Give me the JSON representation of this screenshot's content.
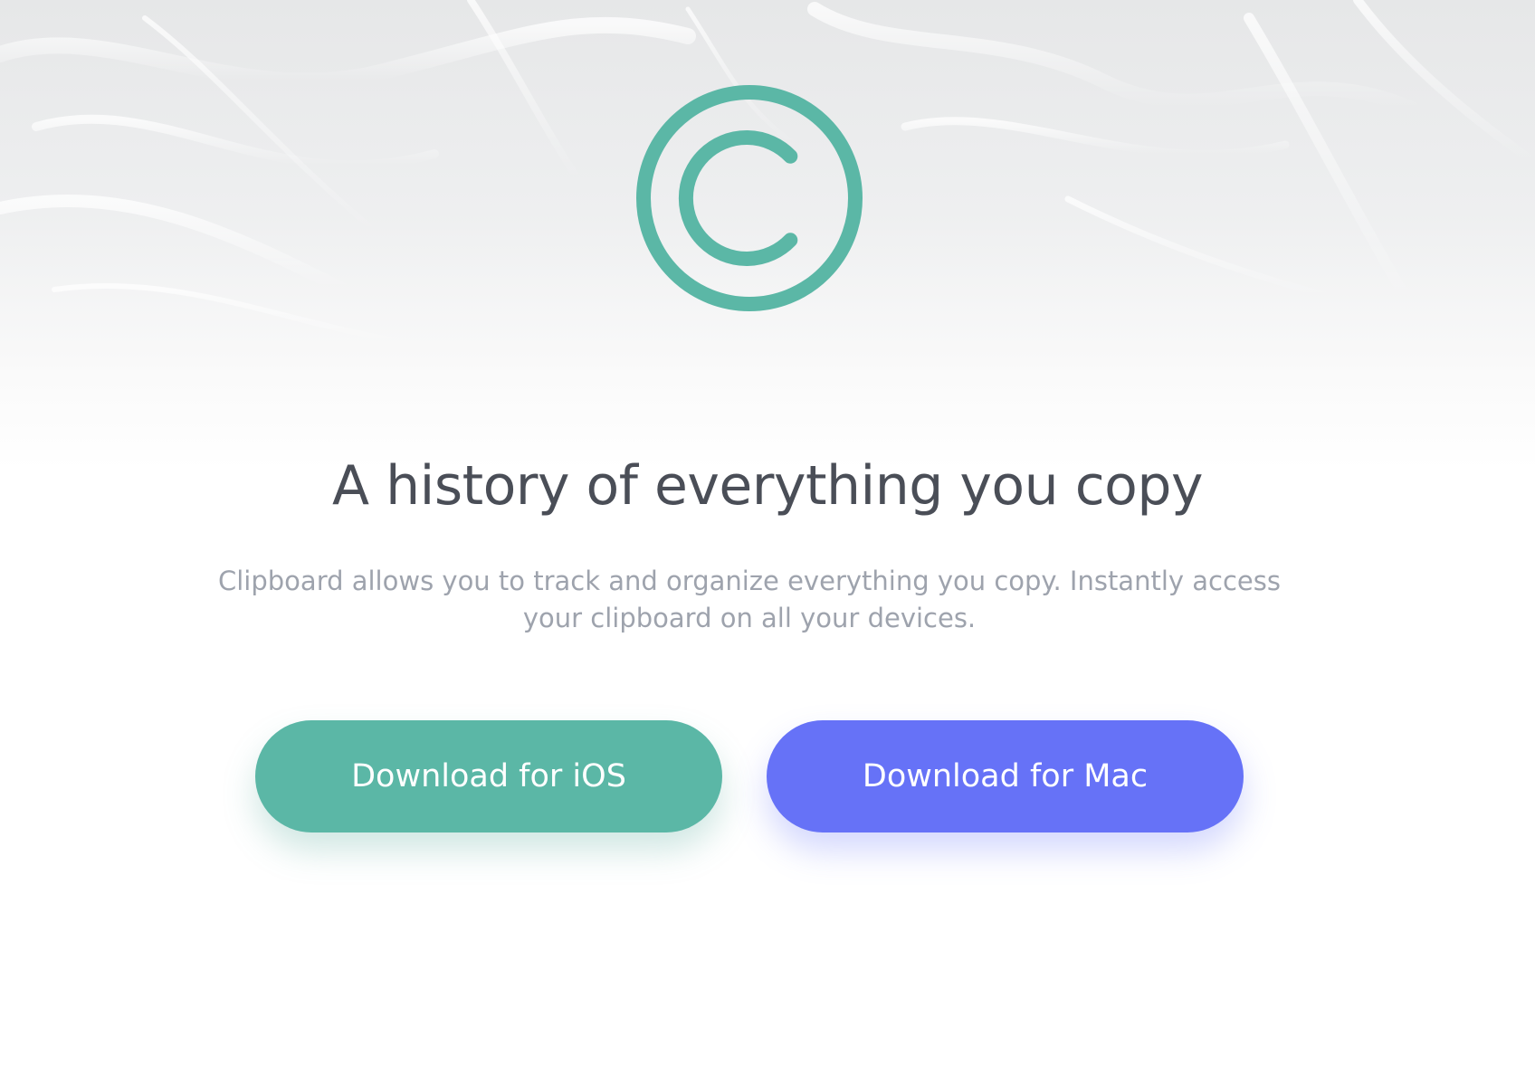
{
  "logo": {
    "icon": "copyright-icon",
    "color": "#5bb7a6"
  },
  "hero": {
    "headline": "A history of everything you copy",
    "subtitle": "Clipboard allows you to track and organize everything you copy. Instantly access your clipboard on all your devices."
  },
  "buttons": {
    "ios": {
      "label": "Download for iOS",
      "color": "#5bb7a6"
    },
    "mac": {
      "label": "Download for Mac",
      "color": "#6672f7"
    }
  },
  "colors": {
    "headline": "#4a4e57",
    "subtitle": "#9ea3ad",
    "background": "#ffffff"
  }
}
